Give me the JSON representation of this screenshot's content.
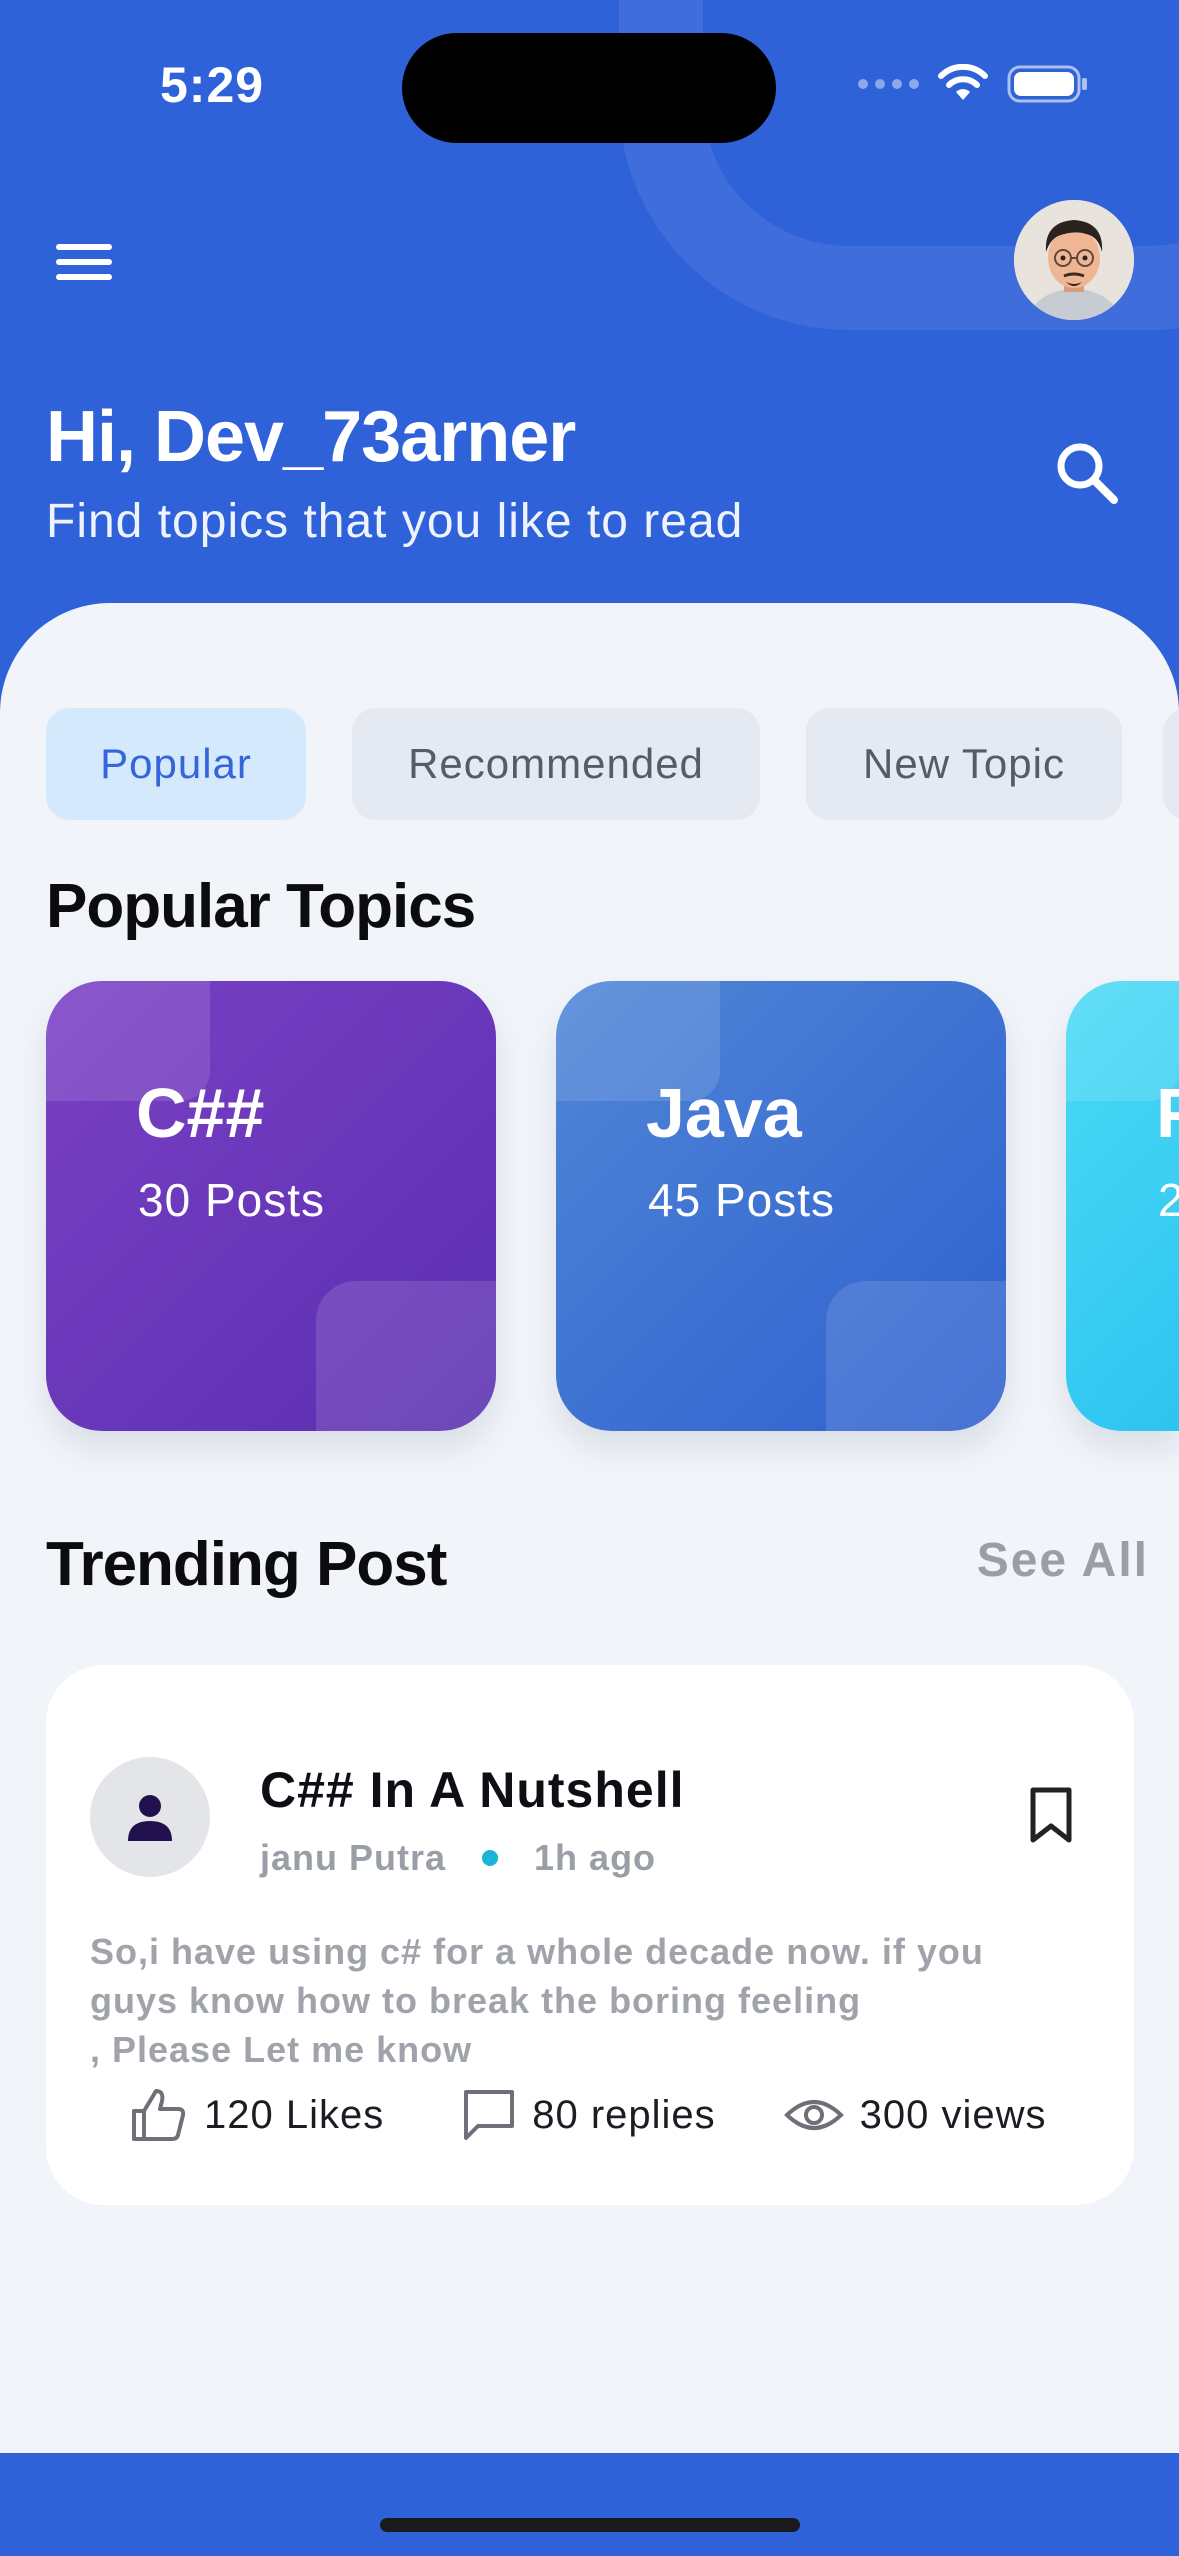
{
  "status_bar": {
    "time": "5:29"
  },
  "header": {
    "greeting": "Hi, Dev_73arner",
    "subtitle": "Find topics that you like to read"
  },
  "tabs": [
    {
      "label": "Popular",
      "active": true
    },
    {
      "label": "Recommended",
      "active": false
    },
    {
      "label": "New Topic",
      "active": false
    }
  ],
  "popular": {
    "title": "Popular Topics",
    "cards": [
      {
        "name": "C##",
        "posts": "30 Posts",
        "color": "#6a3bbd"
      },
      {
        "name": "Java",
        "posts": "45 Posts",
        "color": "#3f74d6"
      },
      {
        "name": "P",
        "posts": "2",
        "color": "#3ed2f3"
      }
    ]
  },
  "trending": {
    "title": "Trending Post",
    "see_all": "See All",
    "post": {
      "title": "C## In A Nutshell",
      "author": "janu Putra",
      "time": "1h ago",
      "body": "So,i have using c# for a whole decade now. if you\nguys know how to break the boring feeling\n, Please Let me know",
      "likes": "120 Likes",
      "replies": "80 replies",
      "views": "300 views"
    }
  },
  "colors": {
    "header_blue": "#2f62d9",
    "active_tab_bg": "#d4e9fb",
    "active_tab_text": "#3565d9",
    "online_dot": "#1bb3d8"
  }
}
